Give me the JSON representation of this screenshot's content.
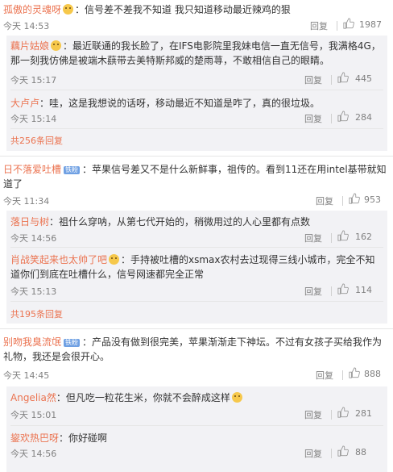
{
  "actions": {
    "reply": "回复"
  },
  "thread1": {
    "user": "孤傲的灵魂呀",
    "text": "：信号差不差我不知道  我只知道移动最近辣鸡的狠",
    "time": "今天 14:53",
    "likes": "1987",
    "replies": [
      {
        "user": "藕片姑娘",
        "text": "：最近联通的我长脸了，在IFS电影院里我妹电信一直无信号，我满格4G，那一刻我仿佛是被端木蕻带去美特斯邦威的楚雨荨，不敢相信自己的眼睛。",
        "time": "今天 15:17",
        "likes": "445"
      },
      {
        "user": "大卢卢",
        "text": "：哇，这是我想说的话呀，移动最近不知道是咋了，真的很垃圾。",
        "time": "今天 15:14",
        "likes": "284"
      }
    ],
    "more": "共256条回复"
  },
  "thread2": {
    "user": "日不落爱吐槽",
    "badge": "铁粉",
    "text": "：苹果信号差又不是什么新鲜事，祖传的。看到11还在用intel基带就知道了",
    "time": "今天 11:34",
    "likes": "953",
    "replies": [
      {
        "user": "落日与树",
        "text": "：祖什么穿呐，从第七代开始的，稍微用过的人心里都有点数",
        "time": "今天 14:56",
        "likes": "162"
      },
      {
        "user": "肖战笑起来也太帅了吧",
        "text": "：手持被吐槽的xsmax农村去过现得三线小城市，完全不知道你们到底在吐槽什么，信号网速都完全正常",
        "time": "今天 15:13",
        "likes": "114"
      }
    ],
    "more": "共195条回复"
  },
  "thread3": {
    "user": "别吻我臭流氓",
    "badge": "铁粉",
    "text": "：产品没有做到很完美，苹果渐渐走下神坛。不过有女孩子买给我作为礼物，我还是会很开心。",
    "time": "今天 14:45",
    "likes": "888",
    "replies": [
      {
        "user": "Angelia然",
        "text": "：但凡吃一粒花生米，你就不会醉成这样",
        "time": "今天 15:01",
        "likes": "281"
      },
      {
        "user": "鋆欢热巴呀",
        "text": "：你好碰啊",
        "time": "今天 14:56",
        "likes": "88"
      }
    ]
  }
}
